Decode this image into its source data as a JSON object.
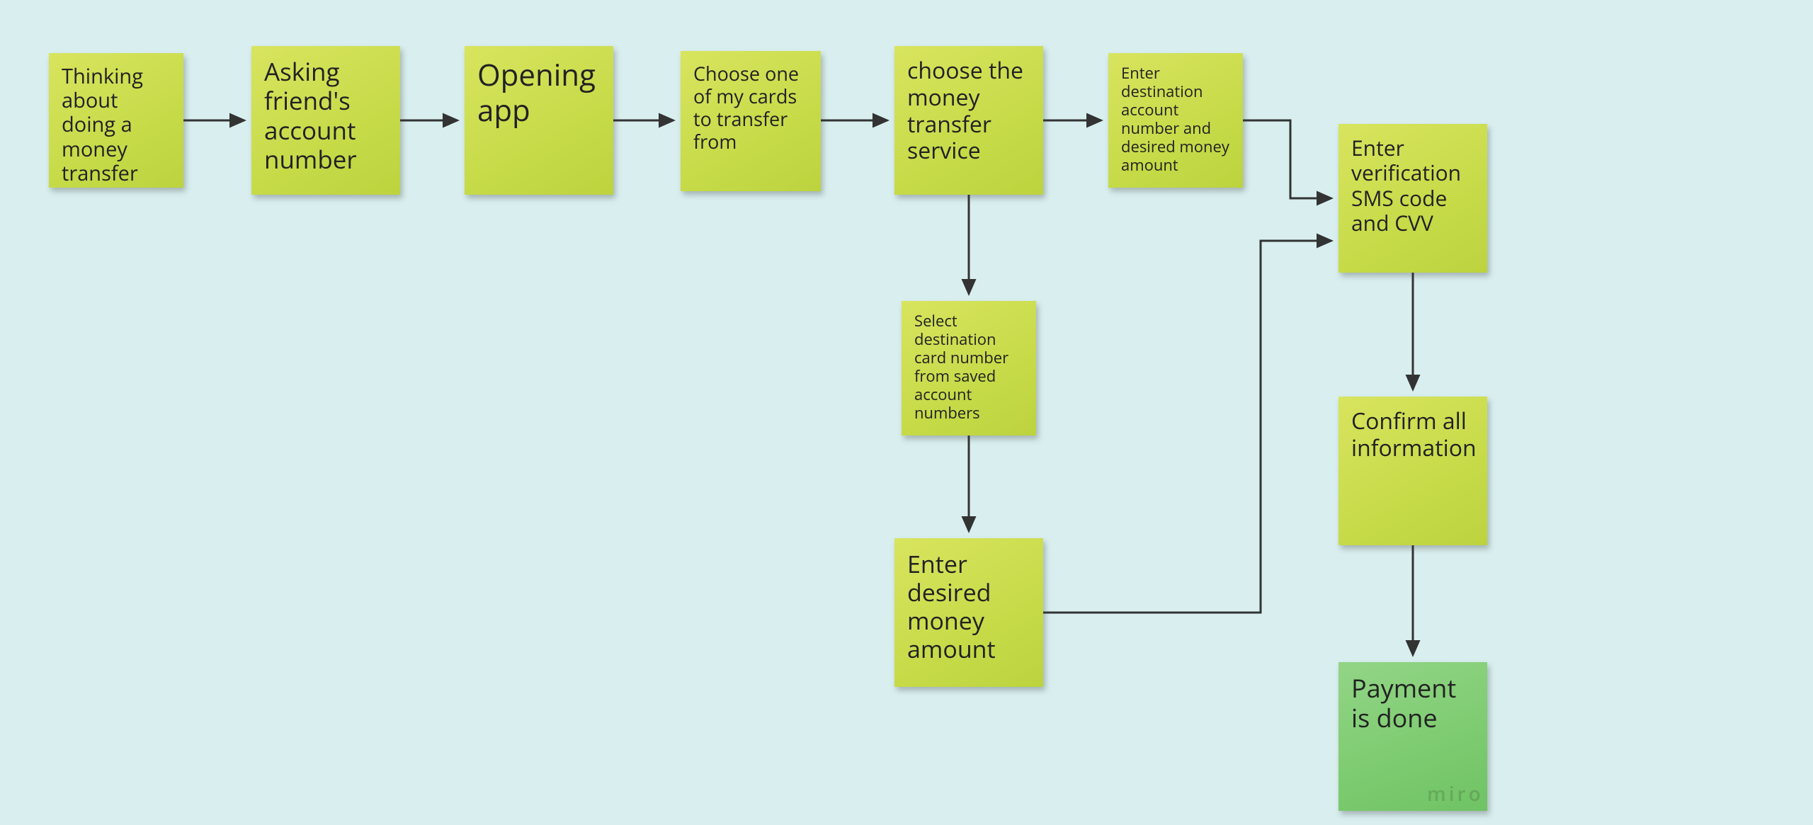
{
  "notes": {
    "n1": {
      "text": "Thinking about doing a money transfer"
    },
    "n2": {
      "text": "Asking friend's account number"
    },
    "n3": {
      "text": "Opening app"
    },
    "n4": {
      "text": "Choose one of my cards to transfer from"
    },
    "n5": {
      "text": "choose the money transfer service"
    },
    "n6": {
      "text": "Enter destination account number and desired money amount"
    },
    "n7": {
      "text": "Enter verification SMS code and CVV"
    },
    "n8": {
      "text": "Select destination card number from saved account numbers"
    },
    "n9": {
      "text": "Enter desired money amount"
    },
    "n10": {
      "text": "Confirm all information"
    },
    "n11": {
      "text": "Payment is done"
    }
  },
  "watermark": "miro",
  "colors": {
    "background": "#d9efef",
    "sticky_yellow": "#c7db49",
    "sticky_green": "#7dcb70",
    "arrow": "#333333"
  }
}
